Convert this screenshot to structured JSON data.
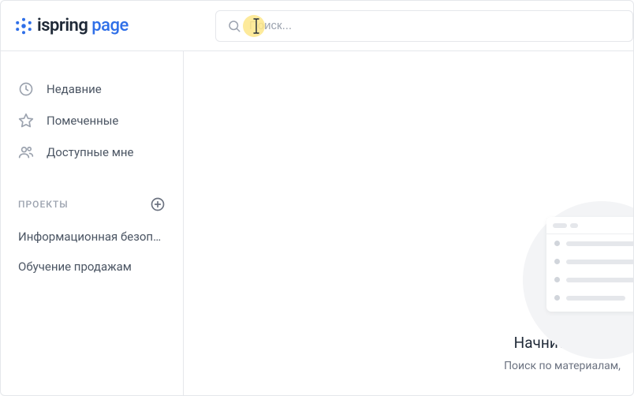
{
  "logo": {
    "brand1": "ispring",
    "brand2": " page"
  },
  "search": {
    "placeholder": "Поиск..."
  },
  "sidebar": {
    "nav": [
      {
        "label": "Недавние"
      },
      {
        "label": "Помеченные"
      },
      {
        "label": "Доступные мне"
      }
    ],
    "projects_title": "ПРОЕКТЫ",
    "projects": [
      {
        "label": "Информационная безоп…"
      },
      {
        "label": "Обучение продажам"
      }
    ]
  },
  "empty": {
    "title": "Начните ввод",
    "subtitle": "Поиск по материалам,"
  }
}
